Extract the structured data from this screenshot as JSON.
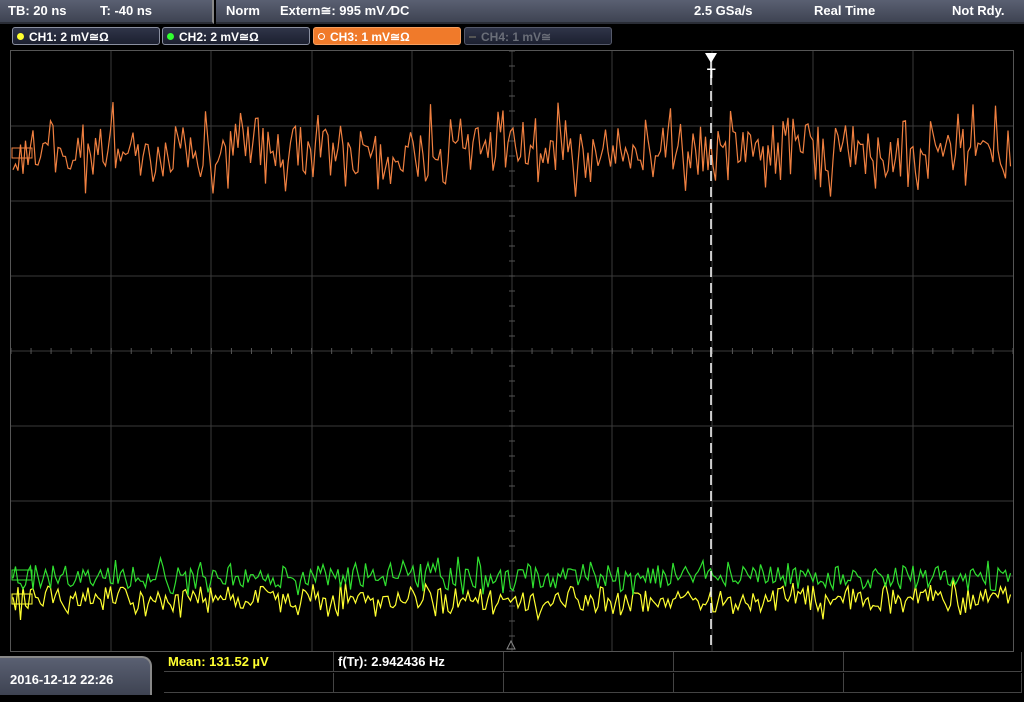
{
  "status": {
    "timebase": "TB: 20 ns",
    "trigger_time": "T: -40 ns",
    "mode": "Norm",
    "trigger_source": "Extern≅: 995 mV ⁄DC",
    "sample_rate": "2.5 GSa/s",
    "acq_mode": "Real Time",
    "state": "Not Rdy."
  },
  "channels": [
    {
      "label": "CH1: 2 mV≅Ω",
      "color": "#ffff30"
    },
    {
      "label": "CH2: 2 mV≅Ω",
      "color": "#30ff30"
    },
    {
      "label": "CH3: 1 mV≅Ω",
      "color": "#ffffff"
    },
    {
      "label": "CH4: 1 mV≅",
      "color": "#666666"
    }
  ],
  "trigger_marker": "T",
  "colors": {
    "ch1": "#ffff30",
    "ch2": "#30e030",
    "ch3": "#f08040",
    "grid": "#3a3a3a",
    "trigger_line": "#ffffff"
  },
  "footer": {
    "datetime": "2016-12-12 22:26",
    "measurements": [
      {
        "label": "Mean: 131.52 µV",
        "color": "#ffff30"
      },
      {
        "label": "f(Tr): 2.942436 Hz",
        "color": "#ffffff"
      }
    ]
  }
}
